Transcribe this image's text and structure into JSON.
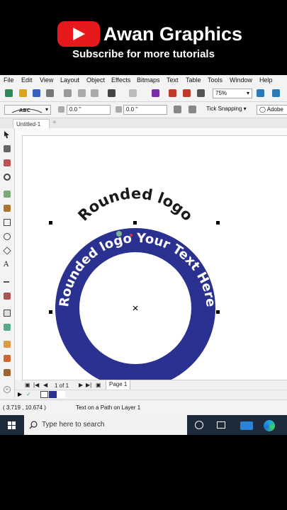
{
  "banner": {
    "title": "Awan Graphics",
    "subtitle": "Subscribe for more tutorials"
  },
  "menu": [
    "File",
    "Edit",
    "View",
    "Layout",
    "Object",
    "Effects",
    "Bitmaps",
    "Text",
    "Table",
    "Tools",
    "Window",
    "Help"
  ],
  "toolbar": {
    "zoom": "75%",
    "x_offset": "0.0 \"",
    "y_offset": "0.0 \"",
    "snapping_label": "Tick Snapping",
    "font_name": "Adobe"
  },
  "document_tab": "Untitled-1",
  "canvas": {
    "outer_text": "Rounded logo",
    "ring_text": "Rounded logo Your Text Here",
    "ring_color": "#2b3190"
  },
  "pagebar": {
    "page_count": "1 of 1",
    "page_tab": "Page 1"
  },
  "status": {
    "coordinates": "( 3.719 , 10.674 )",
    "message": "Text on a Path on Layer 1"
  },
  "taskbar": {
    "search_placeholder": "Type here to search"
  }
}
